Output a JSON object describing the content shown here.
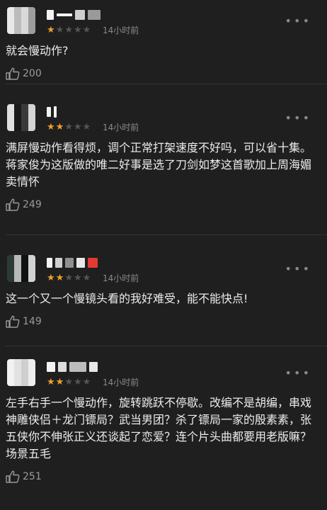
{
  "comments": [
    {
      "stars": [
        "on",
        "off",
        "off",
        "off",
        "off"
      ],
      "time": "14小时前",
      "text": "就会慢动作?",
      "likes": "200"
    },
    {
      "stars": [
        "on",
        "on",
        "off",
        "off",
        "off"
      ],
      "time": "14小时前",
      "text": "满屏慢动作看得烦，调个正常打架速度不好吗，可以省十集。蒋家俊为这版做的唯二好事是选了刀剑如梦这首歌加上周海媚卖情怀",
      "likes": "249"
    },
    {
      "stars": [
        "on",
        "on",
        "off",
        "off",
        "off"
      ],
      "time": "14小时前",
      "text": "这一个又一个慢镜头看的我好难受，能不能快点!",
      "likes": "149"
    },
    {
      "stars": [
        "on",
        "on",
        "off",
        "off",
        "off"
      ],
      "time": "14小时前",
      "text": "左手右手一个慢动作，旋转跳跃不停歇。改编不是胡编，串戏神雕侠侣＋龙门镖局？武当男团？杀了镖局一家的殷素素，张五侠你不伸张正义还谈起了恋爱？连个片头曲都要用老版嘛？场景五毛",
      "likes": "251"
    }
  ],
  "icons": {
    "like": "thumbs-up-icon",
    "more": "more-dots-icon",
    "star": "star-icon"
  },
  "colors": {
    "star_active": "#f0a12a",
    "star_inactive": "#555555",
    "background": "#1f1f1f"
  }
}
